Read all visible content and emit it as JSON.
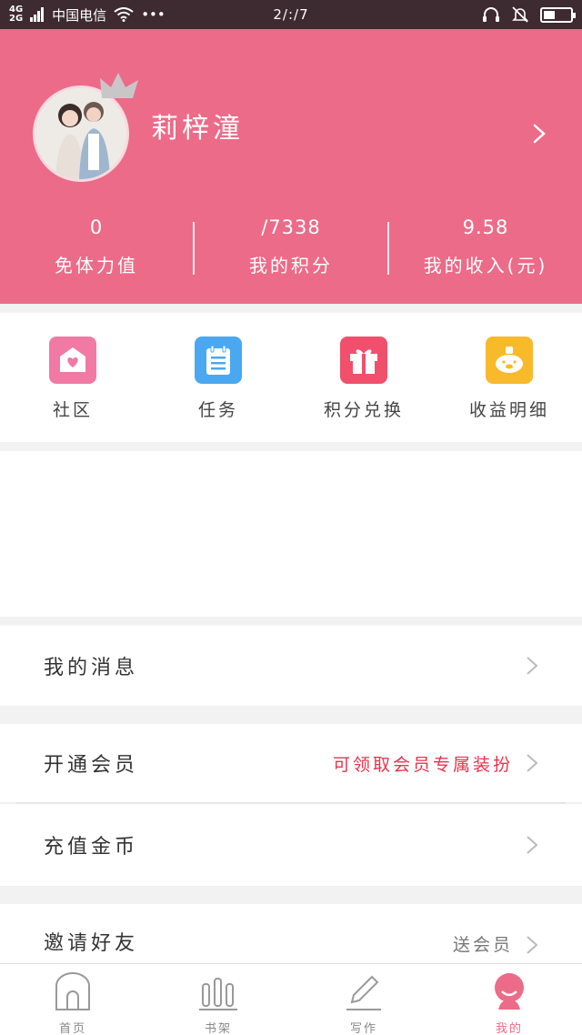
{
  "status_bar": {
    "net1": "4G",
    "net2": "2G",
    "carrier": "中国电信",
    "dots": "•••",
    "time": "2/:/7"
  },
  "profile": {
    "username": "莉梓潼",
    "stats": [
      {
        "value": "0",
        "label": "免体力值"
      },
      {
        "value": "/7338",
        "label": "我的积分"
      },
      {
        "value": "9.58",
        "label": "我的收入(元)"
      }
    ]
  },
  "quick_actions": [
    {
      "label": "社区",
      "icon": "mail-heart-icon",
      "color": "#f07aa3"
    },
    {
      "label": "任务",
      "icon": "clipboard-icon",
      "color": "#4aa8f0"
    },
    {
      "label": "积分兑换",
      "icon": "gift-icon",
      "color": "#f0506c"
    },
    {
      "label": "收益明细",
      "icon": "piggy-bank-icon",
      "color": "#f8b92a"
    }
  ],
  "menu": {
    "messages": {
      "label": "我的消息"
    },
    "vip": {
      "label": "开通会员",
      "extra": "可领取会员专属装扮",
      "extra_color": "#e8334d"
    },
    "recharge": {
      "label": "充值金币"
    },
    "invite": {
      "label": "邀请好友",
      "extra": "送会员"
    }
  },
  "tabbar": [
    {
      "label": "首页",
      "icon": "home-icon"
    },
    {
      "label": "书架",
      "icon": "bookshelf-icon"
    },
    {
      "label": "写作",
      "icon": "pencil-icon"
    },
    {
      "label": "我的",
      "icon": "profile-icon"
    }
  ],
  "colors": {
    "brand": "#ec6b88",
    "status_bar": "#3e2a31"
  }
}
